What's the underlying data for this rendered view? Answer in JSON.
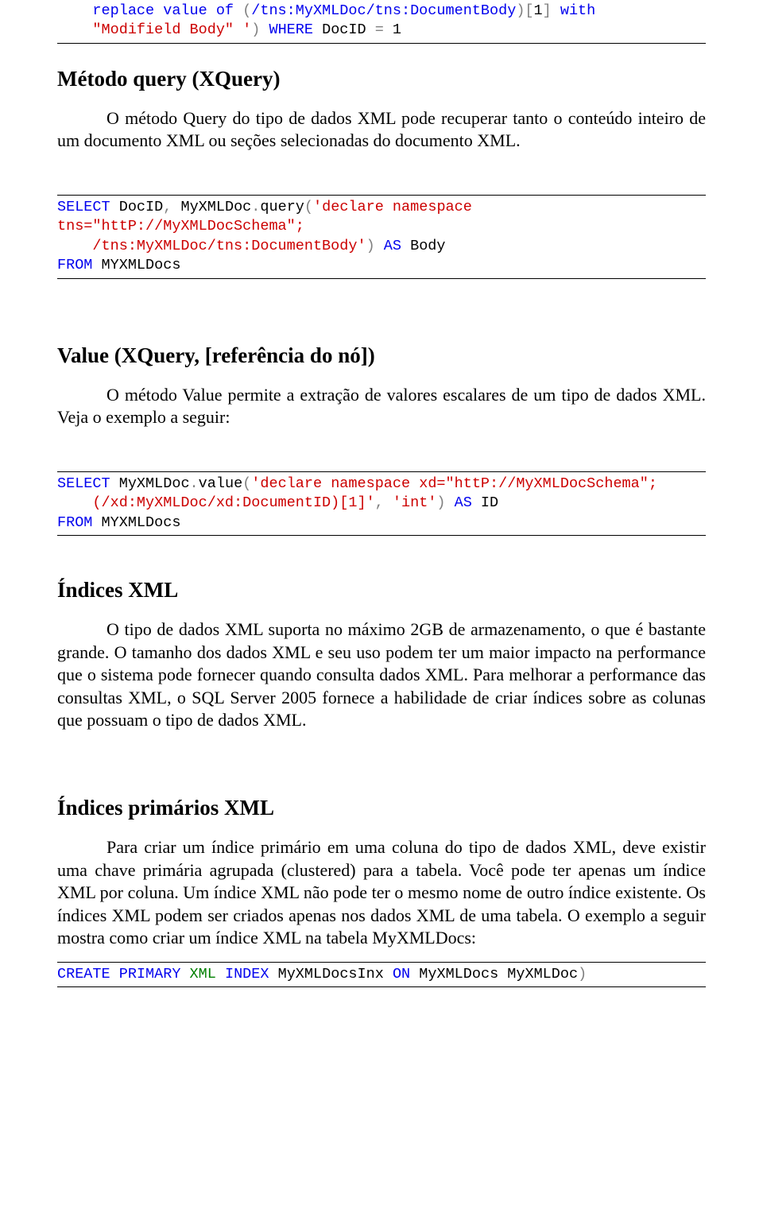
{
  "code1": {
    "l1a": "    replace value of ",
    "l1b": "(",
    "l1c": "/tns:MyXMLDoc/tns:DocumentBody",
    "l1d": ")[",
    "l1e": "1",
    "l1f": "]",
    "l1g": " with",
    "l2a": "    \"Modifield Body\" '",
    "l2b": ")",
    "l2c": " WHERE",
    "l2d": " DocID ",
    "l2e": "=",
    "l2f": " 1"
  },
  "sec1": {
    "title": "Método query (XQuery)",
    "para": "O método Query do tipo de dados XML pode recuperar tanto o conteúdo inteiro de um documento XML ou seções selecionadas do documento XML."
  },
  "code2": {
    "l1a": "SELECT",
    "l1b": " DocID",
    "l1c": ",",
    "l1d": " MyXMLDoc",
    "l1e": ".",
    "l1f": "query",
    "l1g": "(",
    "l1h": "'declare namespace",
    "l2a": "tns=\"httP://MyXMLDocSchema\";",
    "l3a": "    /tns:MyXMLDoc/tns:DocumentBody'",
    "l3b": ")",
    "l3c": " AS",
    "l3d": " Body",
    "l4a": "FROM",
    "l4b": " MYXMLDocs"
  },
  "sec2": {
    "title": "Value (XQuery, [referência do nó])",
    "para": "O método Value permite a extração de valores escalares de um tipo de dados XML. Veja o exemplo a seguir:"
  },
  "code3": {
    "l1a": "SELECT",
    "l1b": " MyXMLDoc",
    "l1c": ".",
    "l1d": "value",
    "l1e": "(",
    "l1f": "'declare namespace xd=\"httP://MyXMLDocSchema\";",
    "l2a": "    (/xd:MyXMLDoc/xd:DocumentID)[1]'",
    "l2b": ",",
    "l2c": " 'int'",
    "l2d": ")",
    "l2e": " AS",
    "l2f": " ID",
    "l3a": "FROM",
    "l3b": " MYXMLDocs"
  },
  "sec3": {
    "title": "Índices XML",
    "para": "O tipo de dados XML suporta no máximo 2GB de armazenamento, o que é bastante grande. O tamanho dos dados XML e seu uso podem ter um maior impacto na performance que o sistema pode fornecer quando consulta dados XML. Para melhorar a performance das consultas XML, o SQL Server 2005 fornece a habilidade de criar índices sobre as colunas que possuam o tipo de dados XML."
  },
  "sec4": {
    "title": "Índices primários XML",
    "para": "Para criar um índice primário em uma coluna do tipo de dados XML, deve existir uma chave primária agrupada (clustered) para a tabela. Você pode ter apenas um índice XML por coluna. Um índice XML não pode ter o mesmo nome de outro índice existente. Os índices XML podem ser criados apenas nos dados XML de uma tabela. O exemplo a seguir mostra como criar um índice XML na tabela MyXMLDocs:"
  },
  "code4": {
    "l1a": "CREATE",
    "l1b": " PRIMARY",
    "l1c": " XML",
    "l1d": " INDEX",
    "l1e": " MyXMLDocsInx ",
    "l1f": "ON",
    "l1g": " MyXMLDocs MyXMLDoc",
    "l1h": ")"
  }
}
